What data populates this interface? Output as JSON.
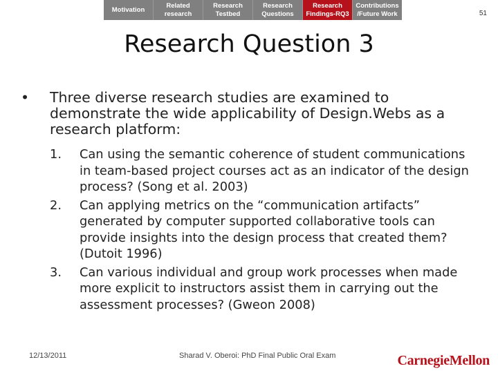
{
  "nav": {
    "tabs": [
      {
        "label": "Motivation",
        "active": false
      },
      {
        "label": "Related research",
        "active": false
      },
      {
        "label": "Research Testbed",
        "active": false
      },
      {
        "label": "Research Questions",
        "active": false
      },
      {
        "label": "Research Findings-RQ3",
        "active": true
      },
      {
        "label": "Contributions /Future Work",
        "active": false
      }
    ]
  },
  "slide_number": "51",
  "title": "Research Question 3",
  "bullet": {
    "symbol": "•",
    "text": "Three diverse research studies are examined to demonstrate the wide applicability of Design.Webs as a research platform:"
  },
  "questions": [
    {
      "num": "1.",
      "text": "Can using the semantic coherence of student communications in team-based project courses act as an indicator of the design process? (Song et al. 2003)"
    },
    {
      "num": "2.",
      "text": "Can applying metrics on the “communication artifacts” generated by computer supported collaborative tools can provide insights into the design process that created them? (Dutoit 1996)"
    },
    {
      "num": "3.",
      "text": "Can various individual and group work processes when made more explicit to instructors assist them in carrying out the assessment processes? (Gweon 2008)"
    }
  ],
  "footer": {
    "date": "12/13/2011",
    "center": "Sharad V. Oberoi: PhD Final Public Oral Exam",
    "logo": "CarnegieMellon"
  },
  "colors": {
    "accent": "#b5121b",
    "nav_bg": "#808080"
  }
}
